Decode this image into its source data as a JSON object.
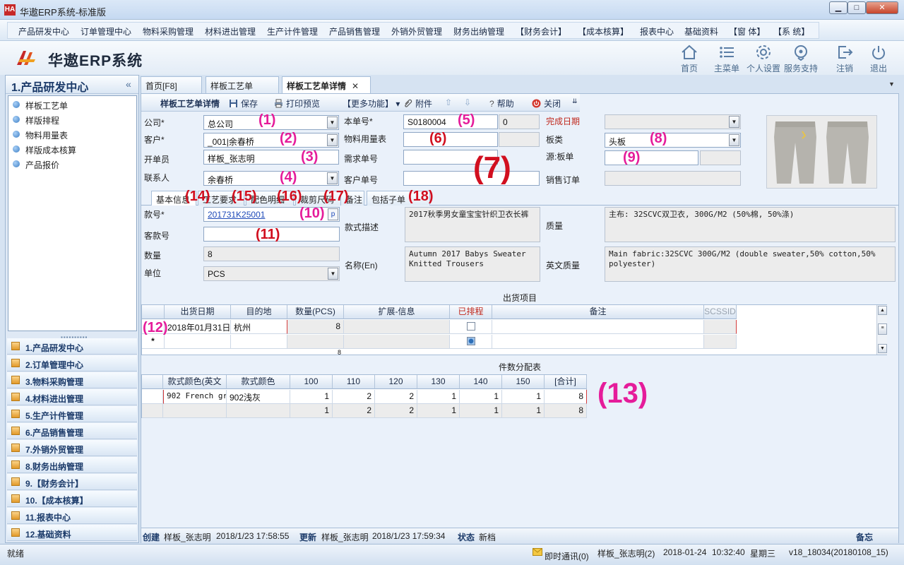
{
  "window": {
    "title": "华遨ERP系统-标准版",
    "logo_mark": "HA"
  },
  "menu": [
    {
      "label": "产品研发中心"
    },
    {
      "label": "订单管理中心"
    },
    {
      "label": "物料采购管理"
    },
    {
      "label": "材料进出管理"
    },
    {
      "label": "生产计件管理"
    },
    {
      "label": "产品销售管理"
    },
    {
      "label": "外销外贸管理"
    },
    {
      "label": "财务出纳管理"
    },
    {
      "label": "【财务会计】"
    },
    {
      "label": "【成本核算】"
    },
    {
      "label": "报表中心"
    },
    {
      "label": "基础资料"
    },
    {
      "label": "【窗 体】"
    },
    {
      "label": "【系 统】"
    }
  ],
  "header": {
    "logo_text": "华遨ERP系统",
    "tools": [
      {
        "label": "首页",
        "icon": "home-icon"
      },
      {
        "label": "主菜单",
        "icon": "menu-icon"
      },
      {
        "label": "个人设置",
        "icon": "gear-icon"
      },
      {
        "label": "服务支持",
        "icon": "support-icon"
      },
      {
        "label": "注销",
        "icon": "logout-icon"
      },
      {
        "label": "退出",
        "icon": "power-icon"
      }
    ]
  },
  "sidebar": {
    "title": "1.产品研发中心",
    "collapse": "«",
    "items": [
      {
        "label": "样板工艺单"
      },
      {
        "label": "样版排程"
      },
      {
        "label": "物料用量表"
      },
      {
        "label": "样版成本核算"
      },
      {
        "label": "产品报价"
      }
    ],
    "grip": "▪▪▪▪▪▪▪▪▪▪",
    "modules": [
      {
        "label": "1.产品研发中心"
      },
      {
        "label": "2.订单管理中心"
      },
      {
        "label": "3.物料采购管理"
      },
      {
        "label": "4.材料进出管理"
      },
      {
        "label": "5.生产计件管理"
      },
      {
        "label": "6.产品销售管理"
      },
      {
        "label": "7.外销外贸管理"
      },
      {
        "label": "8.财务出纳管理"
      },
      {
        "label": "9.【财务会计】"
      },
      {
        "label": "10.【成本核算】"
      },
      {
        "label": "11.报表中心"
      },
      {
        "label": "12.基础资料"
      }
    ]
  },
  "tabs": [
    {
      "label": "首页[F8]"
    },
    {
      "label": "样板工艺单"
    },
    {
      "label": "样板工艺单详情",
      "close": "✕"
    }
  ],
  "tabs_dropdown": "▼",
  "toolbar": {
    "title": "样板工艺单详情",
    "save": "保存",
    "print": "打印预览",
    "more": "【更多功能】",
    "more_arrow": "▾",
    "attach": "附件",
    "help": "帮助",
    "close": "关闭",
    "overflow": "⇊"
  },
  "form": {
    "company_label": "公司*",
    "company_value": "总公司",
    "customer_label": "客户*",
    "customer_value": "_001|余春桥",
    "creator_label": "开单员",
    "creator_value": "样板_张志明",
    "contact_label": "联系人",
    "contact_value": "余春桥",
    "doc_no_label": "本单号*",
    "doc_no_value": "S0180004",
    "doc_no_extra": "0",
    "material_label": "物料用量表",
    "material_value": "",
    "demand_label": "需求单号",
    "demand_value": "",
    "customer_order_label": "客户单号",
    "customer_order_value": "",
    "complete_label": "完成日期",
    "complete_value": "",
    "board_label": "板类",
    "board_value": "头板",
    "source_label": "源:板单",
    "source_value": "",
    "sales_order_label": "销售订单",
    "sales_order_value": "",
    "dropdown_arrow": "▼"
  },
  "annotations": {
    "a1": "(1)",
    "a2": "(2)",
    "a3": "(3)",
    "a4": "(4)",
    "a5": "(5)",
    "a6": "(6)",
    "a7": "(7)",
    "a8": "(8)",
    "a9": "(9)",
    "a10": "(10)",
    "a11": "(11)",
    "a12": "(12)",
    "a13": "(13)",
    "a14": "(14)",
    "a15": "(15)",
    "a16": "(16)",
    "a17": "(17)",
    "a18": "(18)"
  },
  "subtabs": [
    {
      "label": "基本信息"
    },
    {
      "label": "工艺要求"
    },
    {
      "label": "配色明细"
    },
    {
      "label": "裁剪尺码"
    },
    {
      "label": "备注"
    },
    {
      "label": "包括子单"
    }
  ],
  "detail": {
    "style_no_label": "款号*",
    "style_no_value": "201731K25001",
    "style_no_btn": "p",
    "cust_style_label": "客款号",
    "cust_style_value": "",
    "qty_label": "数量",
    "qty_value": "8",
    "unit_label": "单位",
    "unit_value": "PCS",
    "desc_label": "款式描述",
    "desc_value": "2017秋季男女童宝宝针织卫衣长裤",
    "name_en_label": "名称(En)",
    "name_en_value": "Autumn 2017 Babys Sweater Knitted Trousers",
    "quality_label": "质量",
    "quality_value": "主布: 32SCVC双卫衣, 300G/M2 (50%棉, 50%涤)",
    "quality_en_label": "英文质量",
    "quality_en_value": "Main fabric:32SCVC 300G/M2 (double sweater,50% cotton,50% polyester)"
  },
  "shipment": {
    "title": "出货项目",
    "columns": [
      "出货日期",
      "目的地",
      "数量(PCS)",
      "扩展-信息",
      "已排程",
      "备注",
      "SCSSID"
    ],
    "rows": [
      {
        "date": "2018年01月31日",
        "dest": "杭州",
        "qty": "8",
        "ext": "",
        "scheduled": false,
        "note": "",
        "id": ""
      }
    ],
    "new_row_marker": "*",
    "total": "8"
  },
  "distribution": {
    "title": "件数分配表",
    "columns": [
      "款式颜色(英文",
      "款式颜色",
      "100",
      "110",
      "120",
      "130",
      "140",
      "150",
      "[合计]"
    ],
    "rows": [
      {
        "color_en": "902 French gr",
        "color": "902浅灰",
        "v": [
          "1",
          "2",
          "2",
          "1",
          "1",
          "1",
          "8"
        ]
      }
    ],
    "totals": [
      "1",
      "2",
      "2",
      "1",
      "1",
      "1",
      "8"
    ]
  },
  "statusline": {
    "created_label": "创建",
    "created_by": "样板_张志明",
    "created_at": "2018/1/23 17:58:55",
    "updated_label": "更新",
    "updated_by": "样板_张志明",
    "updated_at": "2018/1/23 17:59:34",
    "state_label": "状态",
    "state_value": "新档",
    "memo_label": "备忘"
  },
  "bottombar": {
    "ready": "就绪",
    "im": "即时通讯(0)",
    "user": "样板_张志明(2)",
    "date": "2018-01-24",
    "time": "10:32:40",
    "weekday": "星期三",
    "version": "v18_18034(20180108_15)"
  },
  "colors": {
    "annotation_magenta": "#e51c9a",
    "annotation_red": "#d10f1f",
    "accent": "#1c3b6a"
  }
}
